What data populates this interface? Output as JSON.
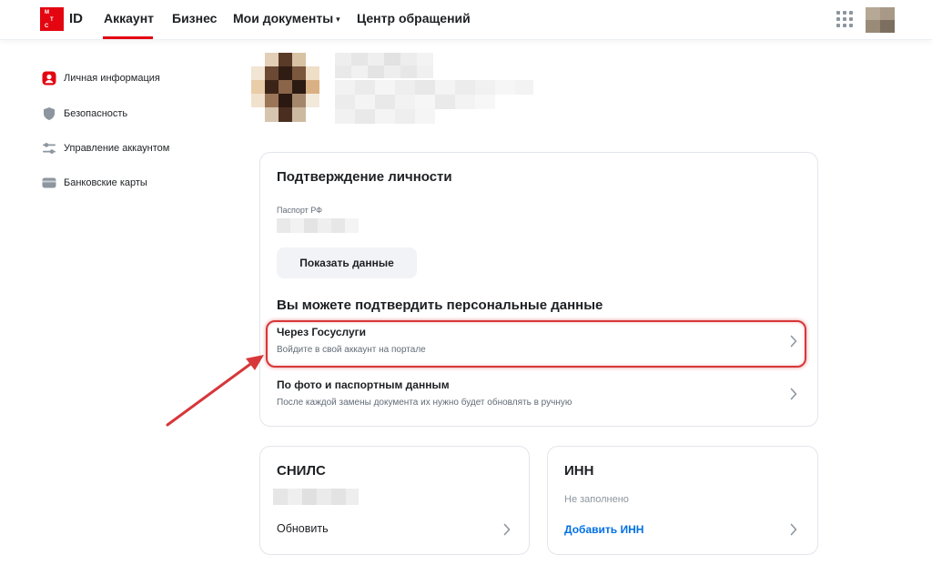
{
  "colors": {
    "brand": "#e30611",
    "link": "#0070e5",
    "highlight": "#d7373a",
    "muted": "#626c77"
  },
  "header": {
    "logo_letters": [
      "М",
      "Т",
      "С"
    ],
    "logo_text": "ID",
    "nav": [
      {
        "label": "Аккаунт",
        "active": true
      },
      {
        "label": "Бизнес"
      },
      {
        "label": "Мои документы",
        "caret": "▾"
      },
      {
        "label": "Центр обращений"
      }
    ],
    "apps_icon": "grid-icon",
    "user_avatar": "avatar-image"
  },
  "sidebar": {
    "items": [
      {
        "label": "Личная информация",
        "icon": "user-icon"
      },
      {
        "label": "Безопасность",
        "icon": "shield-icon"
      },
      {
        "label": "Управление аккаунтом",
        "icon": "sliders-icon"
      },
      {
        "label": "Банковские карты",
        "icon": "card-icon"
      }
    ]
  },
  "identity": {
    "title": "Подтверждение личности",
    "passport_label": "Паспорт РФ",
    "show_button": "Показать данные",
    "confirm_heading": "Вы можете подтвердить персональные данные",
    "options": [
      {
        "title": "Через Госуслуги",
        "subtitle": "Войдите в свой аккаунт на портале"
      },
      {
        "title": "По фото и паспортным данным",
        "subtitle": "После каждой замены документа их нужно будет обновлять в ручную"
      }
    ]
  },
  "snils": {
    "title": "СНИЛС",
    "action": "Обновить"
  },
  "inn": {
    "title": "ИНН",
    "status": "Не заполнено",
    "action": "Добавить ИНН"
  }
}
